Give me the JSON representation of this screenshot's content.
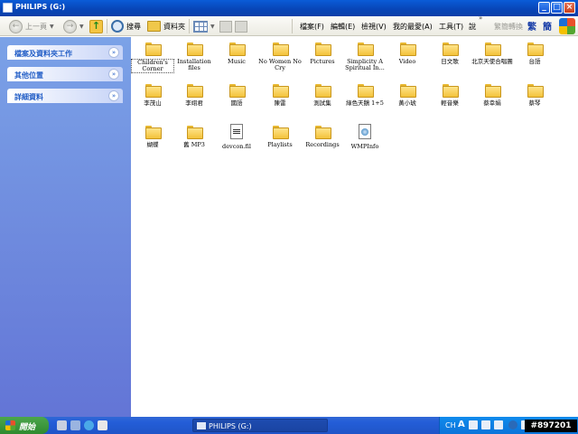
{
  "window": {
    "title": "PHILIPS (G:)"
  },
  "toolbar": {
    "back_label": "上一頁",
    "search_label": "搜尋",
    "folders_label": "資料夾"
  },
  "menubar": [
    "檔案(F)",
    "編輯(E)",
    "檢視(V)",
    "我的最愛(A)",
    "工具(T)",
    "說"
  ],
  "extra": {
    "ime_label": "繁簡轉換",
    "trad": "繁",
    "simp": "簡"
  },
  "sidebar": {
    "panels": [
      {
        "label": "檔案及資料夾工作"
      },
      {
        "label": "其他位置"
      },
      {
        "label": "詳細資料"
      }
    ]
  },
  "items": [
    {
      "name": "Children's Corner",
      "type": "folder",
      "selected": true
    },
    {
      "name": "Installation files",
      "type": "folder"
    },
    {
      "name": "Music",
      "type": "folder"
    },
    {
      "name": "No Women No Cry",
      "type": "folder"
    },
    {
      "name": "Pictures",
      "type": "folder"
    },
    {
      "name": "Simplicity A Spiritual In...",
      "type": "folder"
    },
    {
      "name": "Video",
      "type": "folder"
    },
    {
      "name": "日文歌",
      "type": "folder"
    },
    {
      "name": "北京天使合唱團",
      "type": "folder"
    },
    {
      "name": "台語",
      "type": "folder"
    },
    {
      "name": "李茂山",
      "type": "folder"
    },
    {
      "name": "李翊君",
      "type": "folder"
    },
    {
      "name": "國語",
      "type": "folder"
    },
    {
      "name": "陳雷",
      "type": "folder"
    },
    {
      "name": "測試集",
      "type": "folder"
    },
    {
      "name": "綠色天鵝 1+5",
      "type": "folder"
    },
    {
      "name": "黃小琥",
      "type": "folder"
    },
    {
      "name": "輕音樂",
      "type": "folder"
    },
    {
      "name": "蔡幸娟",
      "type": "folder"
    },
    {
      "name": "蔡琴",
      "type": "folder"
    },
    {
      "name": "蝴蝶",
      "type": "folder"
    },
    {
      "name": "舊 MP3",
      "type": "folder"
    },
    {
      "name": "devcon.fil",
      "type": "file-dat"
    },
    {
      "name": "Playlists",
      "type": "folder"
    },
    {
      "name": "Recordings",
      "type": "folder"
    },
    {
      "name": "WMPInfo",
      "type": "file-xml"
    }
  ],
  "taskbar": {
    "start_label": "開始",
    "task_label": "PHILIPS (G:)",
    "lang": "CH",
    "font_a": "A",
    "watermark": "#897201"
  }
}
